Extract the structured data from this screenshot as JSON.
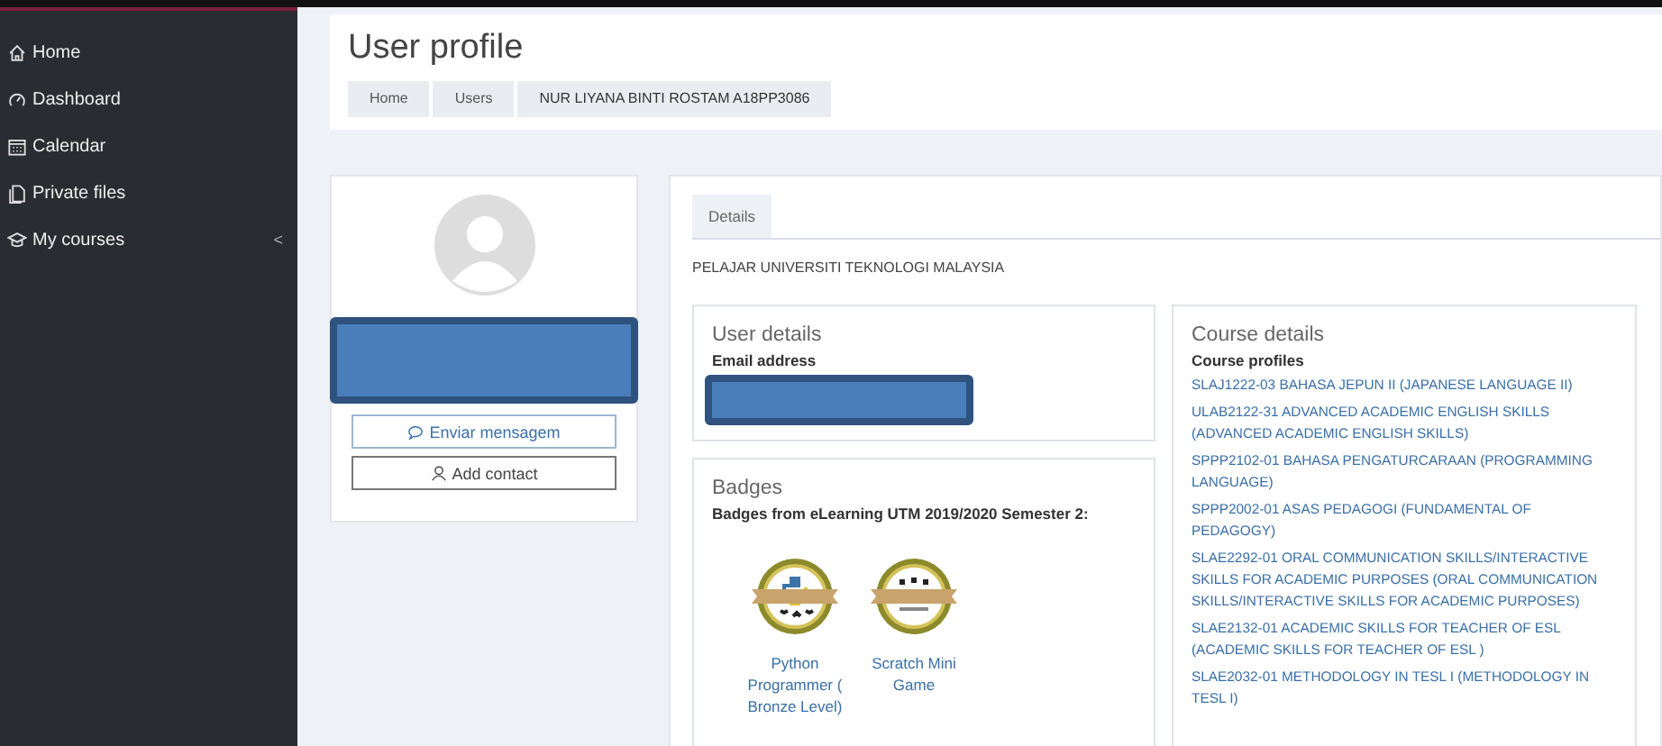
{
  "sidebar": {
    "items": [
      {
        "label": "Home",
        "kind": "home",
        "selected": false
      },
      {
        "label": "Dashboard",
        "kind": "dashboard",
        "selected": false
      },
      {
        "label": "Calendar",
        "kind": "calendar",
        "selected": false
      },
      {
        "label": "Private files",
        "kind": "files",
        "selected": false
      },
      {
        "label": "My courses",
        "kind": "courses",
        "selected": false,
        "caret": "<"
      }
    ]
  },
  "header": {
    "title": "User profile",
    "breadcrumb": [
      "Home",
      "Users",
      "NUR LIYANA BINTI ROSTAM A18PP3086"
    ]
  },
  "profile_card": {
    "buttons": [
      {
        "label": "Enviar mensagem",
        "kind": "message"
      },
      {
        "label": "Add contact",
        "kind": "contact"
      }
    ]
  },
  "tabs": [
    {
      "label": "Details",
      "selected": true
    }
  ],
  "description": "PELAJAR UNIVERSITI TEKNOLOGI MALAYSIA",
  "user_details": {
    "title": "User details",
    "fields": [
      {
        "label": "Email address"
      }
    ]
  },
  "badges": {
    "title": "Badges",
    "subtitle": "Badges from eLearning UTM 2019/2020 Semester 2:",
    "items": [
      {
        "name": "Python Programmer ( Bronze Level)",
        "kind": "python"
      },
      {
        "name": "Scratch Mini Game",
        "kind": "stars"
      }
    ]
  },
  "course_details": {
    "title": "Course details",
    "subtitle": "Course profiles",
    "courses": [
      "SLAJ1222-03 BAHASA JEPUN II (JAPANESE LANGUAGE II)",
      "ULAB2122-31 ADVANCED ACADEMIC ENGLISH SKILLS (ADVANCED ACADEMIC ENGLISH SKILLS)",
      "SPPP2102-01 BAHASA PENGATURCARAAN (PROGRAMMING LANGUAGE)",
      "SPPP2002-01 ASAS PEDAGOGI (FUNDAMENTAL OF PEDAGOGY)",
      "SLAE2292-01 ORAL COMMUNICATION SKILLS/INTERACTIVE SKILLS FOR ACADEMIC PURPOSES (ORAL COMMUNICATION SKILLS/INTERACTIVE SKILLS FOR ACADEMIC PURPOSES)",
      "SLAE2132-01 ACADEMIC SKILLS FOR TEACHER OF ESL (ACADEMIC SKILLS FOR TEACHER OF ESL )",
      "SLAE2032-01 METHODOLOGY IN TESL I (METHODOLOGY IN TESL I)"
    ]
  }
}
